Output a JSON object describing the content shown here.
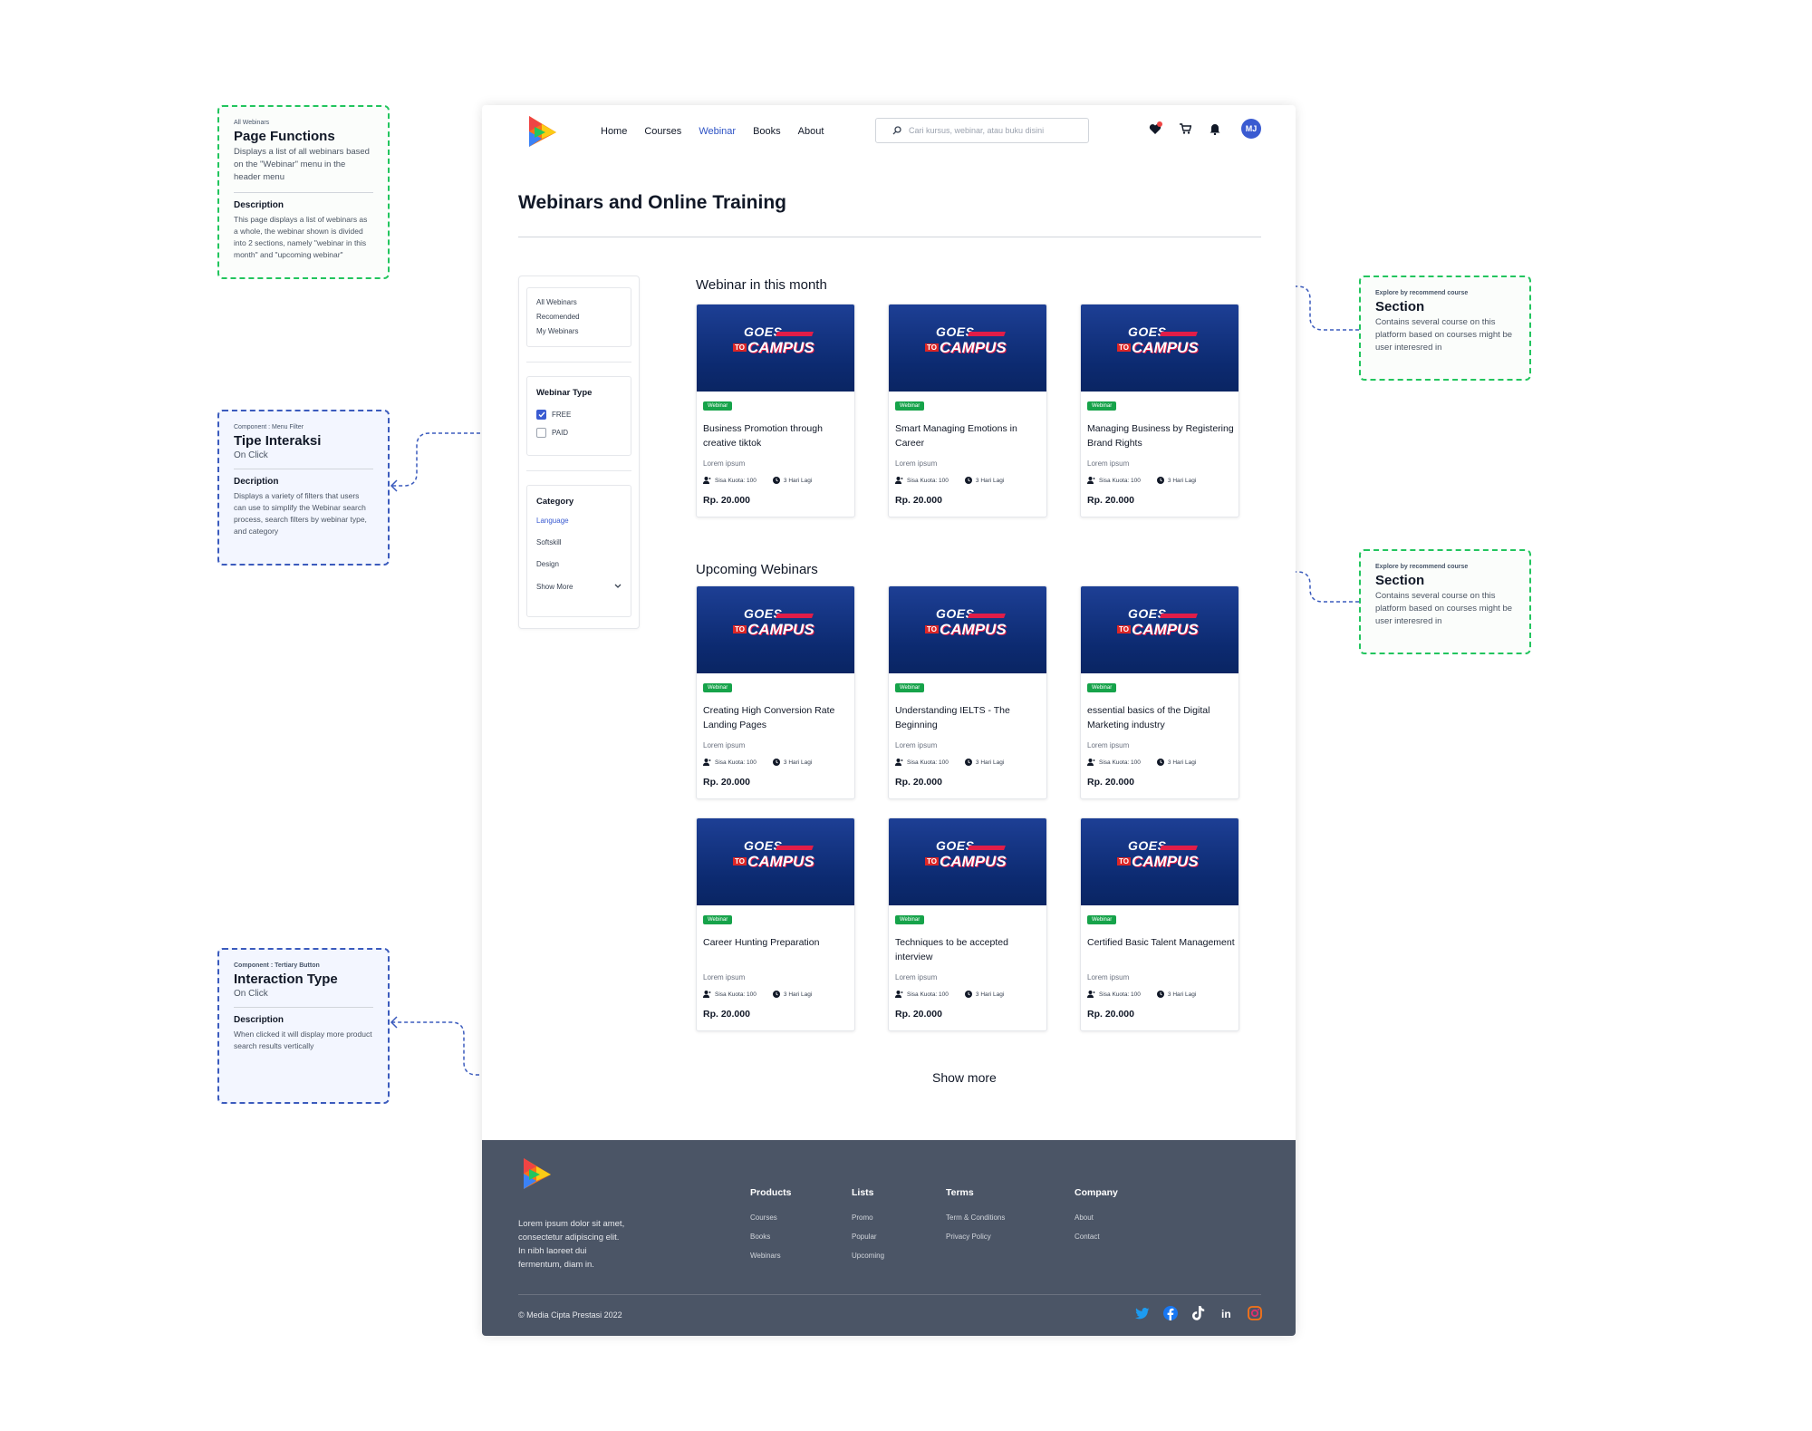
{
  "notes": {
    "page_functions": {
      "eyebrow": "All Webinars",
      "title": "Page Functions",
      "text": "Displays a list of all webinars based on the \"Webinar\" menu in the header menu",
      "desc_heading": "Description",
      "desc": "This page displays a list of webinars as a whole, the webinar shown is divided into 2 sections, namely \"webinar in this month\" and \"upcoming webinar\""
    },
    "tipe_interaksi": {
      "eyebrow": "Component : Menu Filter",
      "title": "Tipe Interaksi",
      "subtitle": "On Click",
      "desc_heading": "Decription",
      "desc": "Displays a variety of filters that users can use to simplify the Webinar search process, search filters by webinar type, and category"
    },
    "interaction_type": {
      "eyebrow": "Component : Tertiary Button",
      "title": "Interaction Type",
      "subtitle": "On Click",
      "desc_heading": "Description",
      "desc": "When clicked it will display more product search results vertically"
    },
    "section_1": {
      "eyebrow": "Explore by recommend course",
      "title": "Section",
      "text": "Contains several course on this platform based on courses might be user interesred in"
    },
    "section_2": {
      "eyebrow": "Explore by recommend course",
      "title": "Section",
      "text": "Contains several course on this platform based on courses might be user interesred in"
    }
  },
  "header": {
    "nav": [
      "Home",
      "Courses",
      "Webinar",
      "Books",
      "About"
    ],
    "active_nav": "Webinar",
    "search_placeholder": "Cari kursus, webinar, atau buku disini",
    "avatar_initials": "MJ",
    "accent": "#2d52c4"
  },
  "page": {
    "title": "Webinars and Online Training"
  },
  "sidebar": {
    "links": [
      "All Webinars",
      "Recomended",
      "My Webinars"
    ],
    "type_heading": "Webinar Type",
    "types": [
      {
        "label": "FREE",
        "checked": true
      },
      {
        "label": "PAID",
        "checked": false
      }
    ],
    "category_heading": "Category",
    "categories": [
      "Language",
      "Softskill",
      "Design"
    ],
    "show_more": "Show More"
  },
  "sections": {
    "this_month": "Webinar in this month",
    "upcoming": "Upcoming Webinars"
  },
  "card_common": {
    "banner_line1": "GOES",
    "banner_to": "TO",
    "banner_line2": "CAMPUS",
    "badge": "Webinar",
    "subtitle": "Lorem ipsum",
    "quota": "Sisa Kuota: 100",
    "time_left": "3 Hari Lagi",
    "price": "Rp. 20.000"
  },
  "this_month_cards": [
    {
      "title": "Business Promotion through creative tiktok"
    },
    {
      "title": "Smart Managing Emotions in Career"
    },
    {
      "title": "Managing Business by Registering Brand Rights"
    }
  ],
  "upcoming_cards": [
    {
      "title": "Creating High Conversion Rate Landing Pages"
    },
    {
      "title": "Understanding IELTS - The Beginning"
    },
    {
      "title": "essential basics of the Digital Marketing industry"
    },
    {
      "title": "Career Hunting Preparation"
    },
    {
      "title": "Techniques to be accepted interview"
    },
    {
      "title": "Certified Basic Talent Management"
    }
  ],
  "show_more": "Show more",
  "footer": {
    "description": "Lorem ipsum dolor sit amet, consectetur adipiscing elit. In nibh laoreet dui fermentum, diam in.",
    "columns": [
      {
        "heading": "Products",
        "links": [
          "Courses",
          "Books",
          "Webinars"
        ]
      },
      {
        "heading": "Lists",
        "links": [
          "Promo",
          "Popular",
          "Upcoming"
        ]
      },
      {
        "heading": "Terms",
        "links": [
          "Term & Conditions",
          "Privacy Policy"
        ]
      },
      {
        "heading": "Company",
        "links": [
          "About",
          "Contact"
        ]
      }
    ],
    "copyright": "© Media Cipta Prestasi 2022",
    "social_icons": [
      "twitter-icon",
      "facebook-icon",
      "tiktok-icon",
      "linkedin-icon",
      "instagram-icon"
    ]
  }
}
